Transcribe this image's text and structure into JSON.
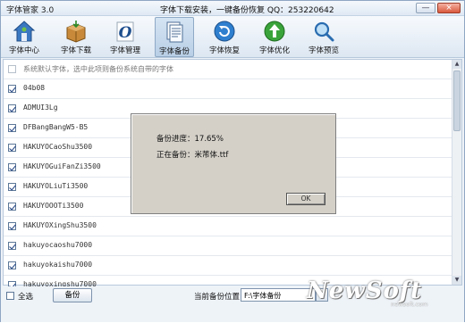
{
  "window": {
    "app_title": "字体管家 3.0",
    "slogan": "字体下载安装，一键备份恢复  QQ：253220642",
    "minimize_glyph": "—",
    "close_glyph": "×"
  },
  "toolbar": {
    "items": [
      {
        "label": "字体中心",
        "icon": "font-center-icon"
      },
      {
        "label": "字体下载",
        "icon": "font-download-icon"
      },
      {
        "label": "字体管理",
        "icon": "font-manage-icon"
      },
      {
        "label": "字体备份",
        "icon": "font-backup-icon",
        "active": true
      },
      {
        "label": "字体恢复",
        "icon": "font-restore-icon"
      },
      {
        "label": "字体优化",
        "icon": "font-optimize-icon"
      },
      {
        "label": "字体预览",
        "icon": "font-preview-icon"
      }
    ]
  },
  "list": {
    "system_note": "系统默认字体，选中此项则备份系统自带的字体",
    "fonts": [
      "04b08",
      "ADMUI3Lg",
      "DFBangBangW5-B5",
      "HAKUYOCaoShu3500",
      "HAKUYOGuiFanZi3500",
      "HAKUYOLiuTi3500",
      "HAKUYOOOTi3500",
      "HAKUYOXingShu3500",
      "hakuyocaoshu7000",
      "hakuyokaishu7000",
      "hakuyoxingshu7000"
    ]
  },
  "bottom": {
    "select_all": "全选",
    "backup_button": "备份",
    "path_label": "当前备份位置",
    "path_value": "F:\\字体备份",
    "browse_label": "..."
  },
  "dialog": {
    "progress_text": "备份进度：17.65%",
    "current_file_text": "正在备份：米芾体.ttf",
    "ok_label": "OK"
  },
  "watermark": {
    "text": "NewSoft",
    "sub": "newsoft.com"
  },
  "colors": {
    "accent": "#2b6cc4",
    "toolbar_active": "#b9cfe6"
  }
}
